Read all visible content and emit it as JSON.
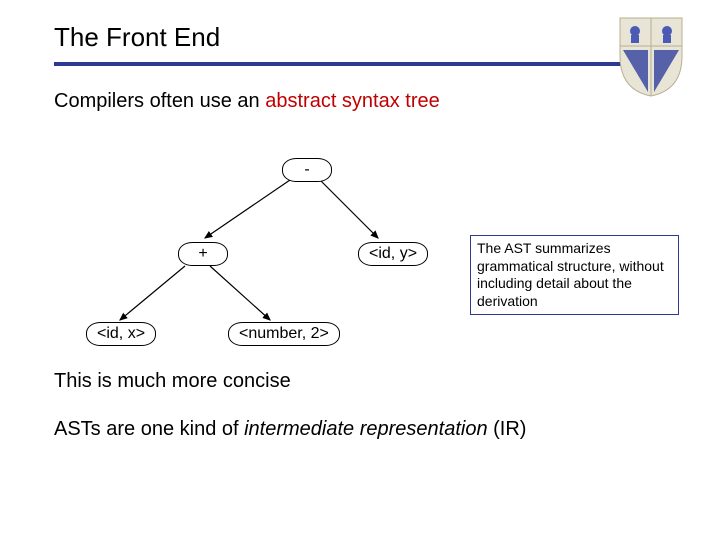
{
  "title": "The Front End",
  "line1_prefix": "Compilers often use an ",
  "line1_em": "abstract syntax tree",
  "tree": {
    "root": "-",
    "left": "+",
    "right": "<id, y>",
    "leaf_left": "<id, x>",
    "leaf_right": "<number, 2>"
  },
  "callout": {
    "l1a": "The ",
    "l1b": "AST",
    "l1c": " summarizes grammatical structure, without including detail about the derivation"
  },
  "line2": "This is much more concise",
  "line3_prefix": "ASTs are one kind of ",
  "line3_em": "intermediate representation",
  "line3_suffix": " (IR)"
}
